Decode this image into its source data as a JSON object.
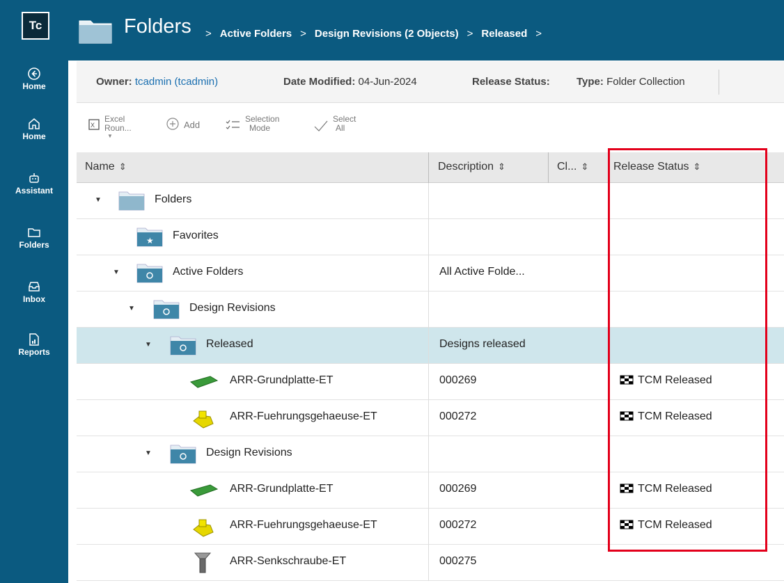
{
  "app": {
    "logo": "Tc"
  },
  "nav": [
    {
      "label": "Home",
      "icon": "back-circle-icon"
    },
    {
      "label": "Home",
      "icon": "home-icon"
    },
    {
      "label": "Assistant",
      "icon": "assistant-robot-icon"
    },
    {
      "label": "Folders",
      "icon": "folder-icon"
    },
    {
      "label": "Inbox",
      "icon": "inbox-icon"
    },
    {
      "label": "Reports",
      "icon": "reports-icon"
    }
  ],
  "header": {
    "title": "Folders",
    "breadcrumb": [
      "Active Folders",
      "Design Revisions (2 Objects)",
      "Released"
    ]
  },
  "props": {
    "owner_label": "Owner:",
    "owner_value": "tcadmin (tcadmin)",
    "date_label": "Date Modified:",
    "date_value": "04-Jun-2024",
    "status_label": "Release Status:",
    "type_label": "Type:",
    "type_value": "Folder Collection"
  },
  "toolbar": {
    "excel_line1": "Excel",
    "excel_line2": "Roun...",
    "add": "Add",
    "selection_line1": "Selection",
    "selection_line2": "Mode",
    "select_line1": "Select",
    "select_line2": "All"
  },
  "columns": {
    "name": "Name",
    "description": "Description",
    "class": "Cl...",
    "release_status": "Release Status"
  },
  "rows": [
    {
      "name": "Folders",
      "desc": "",
      "status": ""
    },
    {
      "name": "Favorites",
      "desc": "",
      "status": ""
    },
    {
      "name": "Active Folders",
      "desc": "All Active Folde...",
      "status": ""
    },
    {
      "name": "Design Revisions",
      "desc": "",
      "status": ""
    },
    {
      "name": "Released",
      "desc": "Designs released",
      "status": ""
    },
    {
      "name": "ARR-Grundplatte-ET",
      "desc": "000269",
      "status": "TCM Released"
    },
    {
      "name": "ARR-Fuehrungsgehaeuse-ET",
      "desc": "000272",
      "status": "TCM Released"
    },
    {
      "name": "Design Revisions",
      "desc": "",
      "status": ""
    },
    {
      "name": "ARR-Grundplatte-ET",
      "desc": "000269",
      "status": "TCM Released"
    },
    {
      "name": "ARR-Fuehrungsgehaeuse-ET",
      "desc": "000272",
      "status": "TCM Released"
    },
    {
      "name": "ARR-Senkschraube-ET",
      "desc": "000275",
      "status": ""
    }
  ],
  "colors": {
    "nav_bg": "#0b5a80",
    "selected_row": "#cfe6ec",
    "highlight": "#e3001b",
    "link": "#1a6fb0"
  }
}
